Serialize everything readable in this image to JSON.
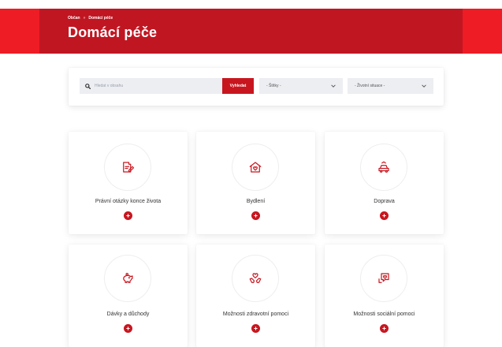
{
  "header": {
    "breadcrumb": [
      "Občan",
      "Domácí péče"
    ],
    "breadcrumb_separator": "»",
    "title": "Domácí péče"
  },
  "filter": {
    "search_placeholder": "Hledat v obsahu",
    "search_button": "Vyhledat",
    "topics_select": "- Štítky -",
    "situations_select": "- Životní situace -"
  },
  "cards": [
    {
      "title": "Právní otázky konce života",
      "icon": "document-edit-icon"
    },
    {
      "title": "Bydlení",
      "icon": "house-icon"
    },
    {
      "title": "Doprava",
      "icon": "vehicle-icon"
    },
    {
      "title": "Dávky a důchody",
      "icon": "piggy-bank-icon"
    },
    {
      "title": "Možnosti zdravotní pomoci",
      "icon": "hands-heart-icon"
    },
    {
      "title": "Možnosti sociální pomoci",
      "icon": "heart-chat-icon"
    }
  ],
  "colors": {
    "brand_red": "#c01622",
    "accent_red": "#ee1c25",
    "button_red": "#c8161f",
    "field_gray": "#eceef2"
  }
}
